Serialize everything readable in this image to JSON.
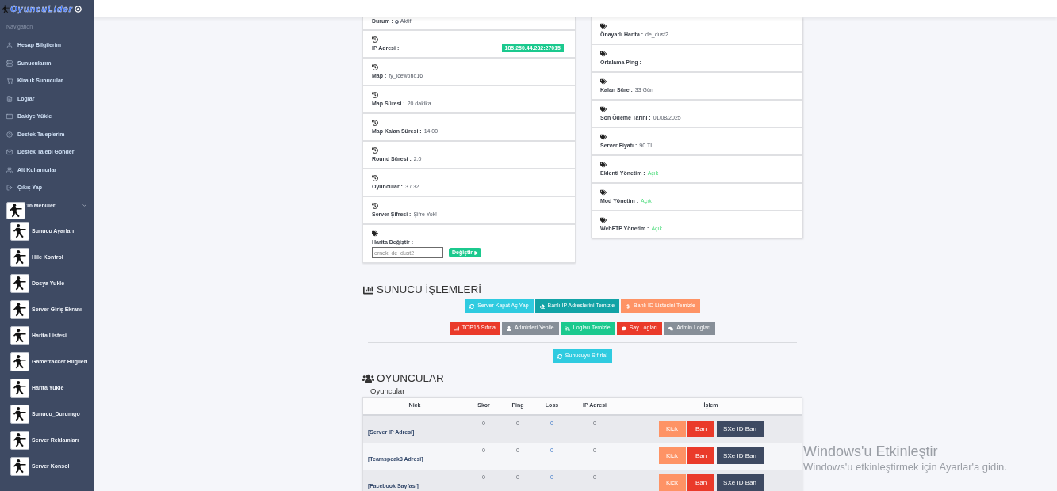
{
  "sidebar": {
    "logo": "OyuncuLider",
    "section_title": "Navigation",
    "items": [
      "Hesap Bilgilerim",
      "Sunucularım",
      "Kiralık Sunucular",
      "Loglar",
      "Bakiye Yükle",
      "Destek Taleplerim",
      "Destek Talebi Gönder",
      "Alt Kullanıcılar",
      "Çıkış Yap"
    ],
    "menu_group": {
      "label": "16 Menüleri",
      "expanded": true,
      "items": [
        "Sunucu Ayarları",
        "Hile Kontrol",
        "Dosya Yukle",
        "Server Giriş Ekranı",
        "Harita Listesi",
        "Gametracker Bilgileri",
        "Harita Yükle",
        "Sunucu_Durumgo",
        "Server Reklamları",
        "Server Konsol"
      ]
    }
  },
  "server_info": {
    "left": [
      {
        "kind": "status",
        "label": "Durum :",
        "value": "Aktif"
      },
      {
        "kind": "badge",
        "label": "IP Adresi :",
        "value": "185.250.44.232:27015"
      },
      {
        "kind": "text",
        "label": "Map :",
        "value": "fy_iceworld16"
      },
      {
        "kind": "text",
        "label": "Map Süresi :",
        "value": "20 dakika"
      },
      {
        "kind": "text",
        "label": "Map Kalan Süresi :",
        "value": "14:00"
      },
      {
        "kind": "text",
        "label": "Round Süresi :",
        "value": "2.0"
      },
      {
        "kind": "text",
        "label": "Oyuncular :",
        "value": "3 / 32"
      },
      {
        "kind": "text",
        "label": "Server Şifresi :",
        "value": "Şifre Yok!"
      },
      {
        "kind": "form",
        "label": "Harita Değiştir :",
        "placeholder": "ornek: de_dust2",
        "button": "Değiştir"
      }
    ],
    "right": [
      {
        "kind": "text",
        "label": "Önayarlı Harita :",
        "value": "de_dust2"
      },
      {
        "kind": "text",
        "label": "Ortalama Ping :"
      },
      {
        "kind": "text",
        "label": "Kalan Süre :",
        "value": "33 Gün"
      },
      {
        "kind": "text",
        "label": "Son Ödeme Tarihi :",
        "value": "01/08/2025"
      },
      {
        "kind": "text",
        "label": "Server Fiyatı :",
        "value": "90 TL"
      },
      {
        "kind": "toggle",
        "label": "Eklenti Yönetim :",
        "value": "Açık",
        "on": true
      },
      {
        "kind": "toggle",
        "label": "Mod Yönetim :",
        "value": "Açık",
        "on": true
      },
      {
        "kind": "toggle",
        "label": "WebFTP Yönetim :",
        "value": "Açık",
        "on": true
      }
    ]
  },
  "operations": {
    "title": "SUNUCU İŞLEMLERİ",
    "button_rows": [
      {
        "buttons": [
          {
            "label": "Server Kapat Aç Yap",
            "color": "#2fcbe0"
          },
          {
            "label": "Banlı IP Adreslerini Temizle",
            "color": "#12a3a6"
          },
          {
            "label": "Banlı ID Listesini Temizle",
            "color": "#fe9365"
          }
        ]
      },
      {
        "buttons": [
          {
            "label": "TOP15 Sıfırla",
            "color": "#ea3a2a"
          },
          {
            "label": "Adminleri Yenile",
            "color": "#878f98"
          },
          {
            "label": "Logları Temizle",
            "color": "#1bc98e"
          },
          {
            "label": "Say Logları",
            "color": "#ea3a2a"
          },
          {
            "label": "Admin Logları",
            "color": "#878f98"
          }
        ]
      }
    ],
    "reset_button": {
      "label": "Sunucuyu Sıfırla!",
      "color": "#2fcbe0"
    }
  },
  "players": {
    "title": "OYUNCULAR",
    "subtitle": "Oyuncular",
    "columns": [
      "Nick",
      "Skor",
      "Ping",
      "Loss",
      "IP Adresi",
      "İşlem"
    ],
    "rows": [
      {
        "nick": "[Server IP Adresi]",
        "score": "0",
        "ping": "0",
        "loss": "0",
        "ip": "0",
        "actions": [
          "Kick",
          "Ban",
          "SXe ID Ban"
        ]
      },
      {
        "nick": "[Teamspeak3 Adresi]",
        "score": "0",
        "ping": "0",
        "loss": "0",
        "ip": "0",
        "actions": [
          "Kick",
          "Ban",
          "SXe ID Ban"
        ]
      },
      {
        "nick": "[Facebook Sayfasi]",
        "score": "0",
        "ping": "0",
        "loss": "0",
        "ip": "0",
        "actions": [
          "Kick",
          "Ban",
          "SXe ID Ban"
        ]
      }
    ]
  },
  "os_notice": {
    "title": "Windows'u Etkinleştir",
    "text": "Windows'u etkinleştirmek için Ayarlar'a gidin."
  }
}
